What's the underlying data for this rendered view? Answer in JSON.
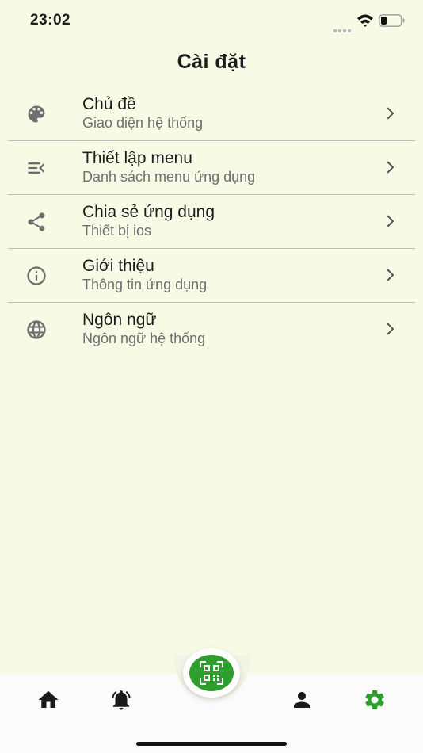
{
  "status_bar": {
    "time": "23:02"
  },
  "header": {
    "title": "Cài đặt"
  },
  "settings": [
    {
      "id": "theme",
      "title": "Chủ đề",
      "subtitle": "Giao diện hệ thống",
      "icon": "palette-icon"
    },
    {
      "id": "menu",
      "title": "Thiết lập menu",
      "subtitle": "Danh sách menu ứng dụng",
      "icon": "menu-open-icon"
    },
    {
      "id": "share",
      "title": "Chia sẻ ứng dụng",
      "subtitle": "Thiết bị ios",
      "icon": "share-icon"
    },
    {
      "id": "about",
      "title": "Giới thiệu",
      "subtitle": "Thông tin ứng dụng",
      "icon": "info-icon"
    },
    {
      "id": "language",
      "title": "Ngôn ngữ",
      "subtitle": "Ngôn ngữ hệ thống",
      "icon": "globe-icon"
    }
  ],
  "bottom_nav": {
    "items": [
      {
        "name": "home",
        "icon": "home-icon"
      },
      {
        "name": "notifications",
        "icon": "bell-icon"
      },
      {
        "name": "scan",
        "icon": "qr-scan-icon"
      },
      {
        "name": "profile",
        "icon": "person-icon"
      },
      {
        "name": "settings",
        "icon": "gear-icon",
        "active": true
      }
    ],
    "active_color": "#2e9e2f",
    "inactive_color": "#1a1a1a"
  },
  "colors": {
    "background": "#f7fbe5",
    "accent": "#2e9e2f",
    "subtitle_text": "#6f6f6f",
    "divider": "#bdbdbd"
  }
}
